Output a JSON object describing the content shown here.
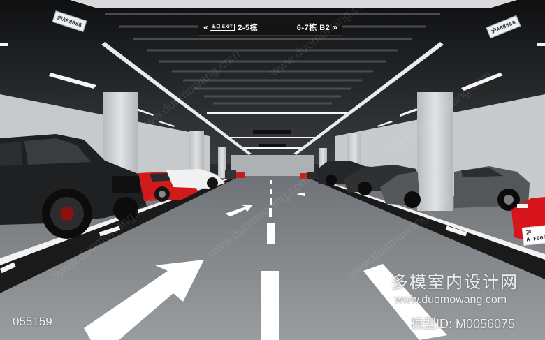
{
  "ceiling_sign": {
    "exit_label": "出口 EXIT",
    "left_text": "2-5栋",
    "right_text": "6-7栋 B2",
    "left_arrows": "«",
    "right_arrows": "»"
  },
  "plates": {
    "left": "沪A88888",
    "right": "沪A88888",
    "car": "沪A·F000"
  },
  "watermark": {
    "code": "055159",
    "brand": "多模室内设计网",
    "url": "www.duomowang.com",
    "model_id": "模型ID: M0056075",
    "diagonal": "www.duomowang.com"
  },
  "colors": {
    "floor": "#8c8f92",
    "ceiling": "#1b1c1e",
    "column": "#cfd2d4",
    "lane_marking": "#ffffff",
    "red_car": "#d11a1a"
  }
}
